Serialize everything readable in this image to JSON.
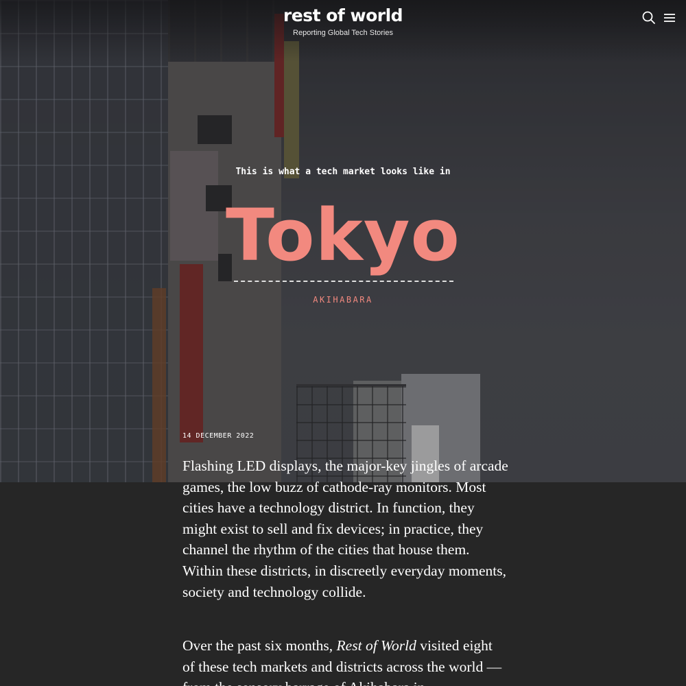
{
  "header": {
    "logo_text": "rest of world",
    "tagline": "Reporting Global Tech Stories",
    "search_icon": "search-icon",
    "menu_icon": "hamburger-menu-icon"
  },
  "hero": {
    "kicker": "This is what a tech market looks like in",
    "city": "Tokyo",
    "district": "AKIHABARA",
    "accent_color": "#f2897f"
  },
  "article": {
    "date": "14 DECEMBER 2022",
    "paragraph_1": "Flashing LED displays, the major-key jingles of arcade games, the low buzz of cathode-ray monitors. Most cities have a technology district. In function, they might exist to sell and fix devices; in practice, they channel the rhythm of the cities that house them. Within these districts, in discreetly everyday moments, society and technology collide.",
    "paragraph_2_start": "Over the past six months, ",
    "paragraph_2_italic": "Rest of World",
    "paragraph_2_rest": " visited eight of these tech markets and districts across the world — from the sensory barrage of Akihabara in"
  }
}
